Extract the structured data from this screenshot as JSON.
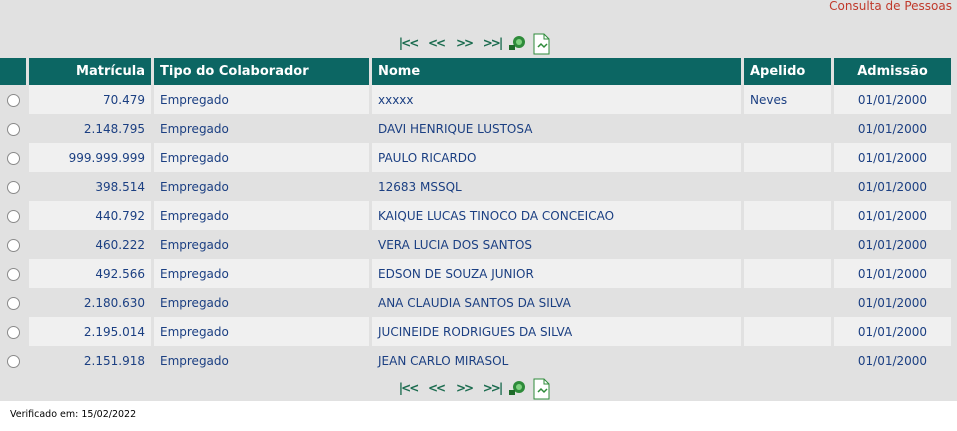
{
  "page_title": "Consulta de Pessoas",
  "pager": {
    "first": "|<<",
    "prev": "<<",
    "next": ">>",
    "last": ">>|"
  },
  "table": {
    "headers": {
      "matricula": "Matrícula",
      "tipo": "Tipo do Colaborador",
      "nome": "Nome",
      "apelido": "Apelido",
      "admissao": "Admissão"
    },
    "rows": [
      {
        "matricula": "70.479",
        "tipo": "Empregado",
        "nome": "xxxxx",
        "apelido": "Neves",
        "admissao": "01/01/2000"
      },
      {
        "matricula": "2.148.795",
        "tipo": "Empregado",
        "nome": "DAVI HENRIQUE LUSTOSA",
        "apelido": "",
        "admissao": "01/01/2000"
      },
      {
        "matricula": "999.999.999",
        "tipo": "Empregado",
        "nome": "PAULO RICARDO",
        "apelido": "",
        "admissao": "01/01/2000"
      },
      {
        "matricula": "398.514",
        "tipo": "Empregado",
        "nome": "12683 MSSQL",
        "apelido": "",
        "admissao": "01/01/2000"
      },
      {
        "matricula": "440.792",
        "tipo": "Empregado",
        "nome": "KAIQUE LUCAS TINOCO DA CONCEICAO",
        "apelido": "",
        "admissao": "01/01/2000"
      },
      {
        "matricula": "460.222",
        "tipo": "Empregado",
        "nome": "VERA LUCIA DOS SANTOS",
        "apelido": "",
        "admissao": "01/01/2000"
      },
      {
        "matricula": "492.566",
        "tipo": "Empregado",
        "nome": "EDSON DE SOUZA JUNIOR",
        "apelido": "",
        "admissao": "01/01/2000"
      },
      {
        "matricula": "2.180.630",
        "tipo": "Empregado",
        "nome": "ANA CLAUDIA SANTOS DA SILVA",
        "apelido": "",
        "admissao": "01/01/2000"
      },
      {
        "matricula": "2.195.014",
        "tipo": "Empregado",
        "nome": "JUCINEIDE RODRIGUES DA SILVA",
        "apelido": "",
        "admissao": "01/01/2000"
      },
      {
        "matricula": "2.151.918",
        "tipo": "Empregado",
        "nome": "JEAN CARLO MIRASOL",
        "apelido": "",
        "admissao": "01/01/2000"
      }
    ]
  },
  "footer": {
    "verified": "Verificado em: 15/02/2022"
  },
  "colors": {
    "header_bg": "#0c6663",
    "title_color": "#c0392b",
    "link_color": "#1b3f82",
    "pager_color": "#1a6b4e"
  }
}
